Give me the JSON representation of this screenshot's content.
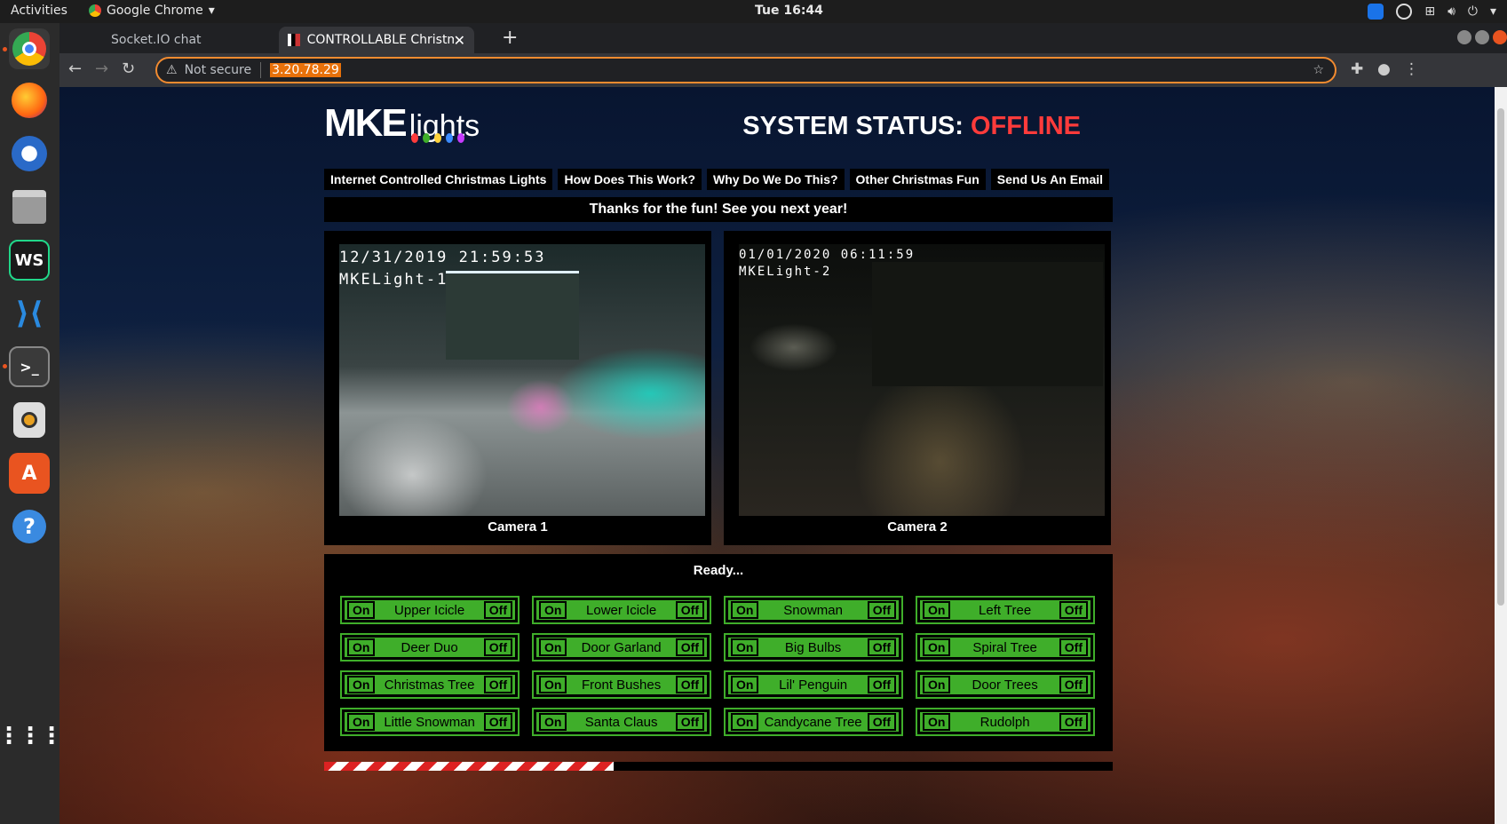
{
  "os": {
    "activities": "Activities",
    "app_name": "Google Chrome",
    "clock": "Tue 16:44"
  },
  "browser": {
    "tabs": [
      {
        "title": "Socket.IO chat"
      },
      {
        "title": "CONTROLLABLE Christmas"
      }
    ],
    "omnibox": {
      "security_label": "Not secure",
      "url": "3.20.78.29"
    }
  },
  "site": {
    "logo_main": "MKE",
    "logo_sub": "lights",
    "status_label": "SYSTEM STATUS:",
    "status_value": "OFFLINE",
    "nav": [
      "Internet Controlled Christmas Lights",
      "How Does This Work?",
      "Why Do We Do This?",
      "Other Christmas Fun",
      "Send Us An Email"
    ],
    "banner": "Thanks for the fun! See you next year!",
    "cameras": [
      {
        "timestamp": "12/31/2019 21:59:53",
        "name": "MKELight-1",
        "label": "Camera 1"
      },
      {
        "timestamp": "01/01/2020 06:11:59",
        "name": "MKELight-2",
        "label": "Camera 2"
      }
    ],
    "ready_text": "Ready...",
    "on_label": "On",
    "off_label": "Off",
    "controls": [
      "Upper Icicle",
      "Lower Icicle",
      "Snowman",
      "Left Tree",
      "Deer Duo",
      "Door Garland",
      "Big Bulbs",
      "Spiral Tree",
      "Christmas Tree",
      "Front Bushes",
      "Lil' Penguin",
      "Door Trees",
      "Little Snowman",
      "Santa Claus",
      "Candycane Tree",
      "Rudolph"
    ]
  },
  "colors": {
    "accent_green": "#3fae2a",
    "offline_red": "#ff3b3b",
    "omnibox_border": "#f28b30"
  }
}
